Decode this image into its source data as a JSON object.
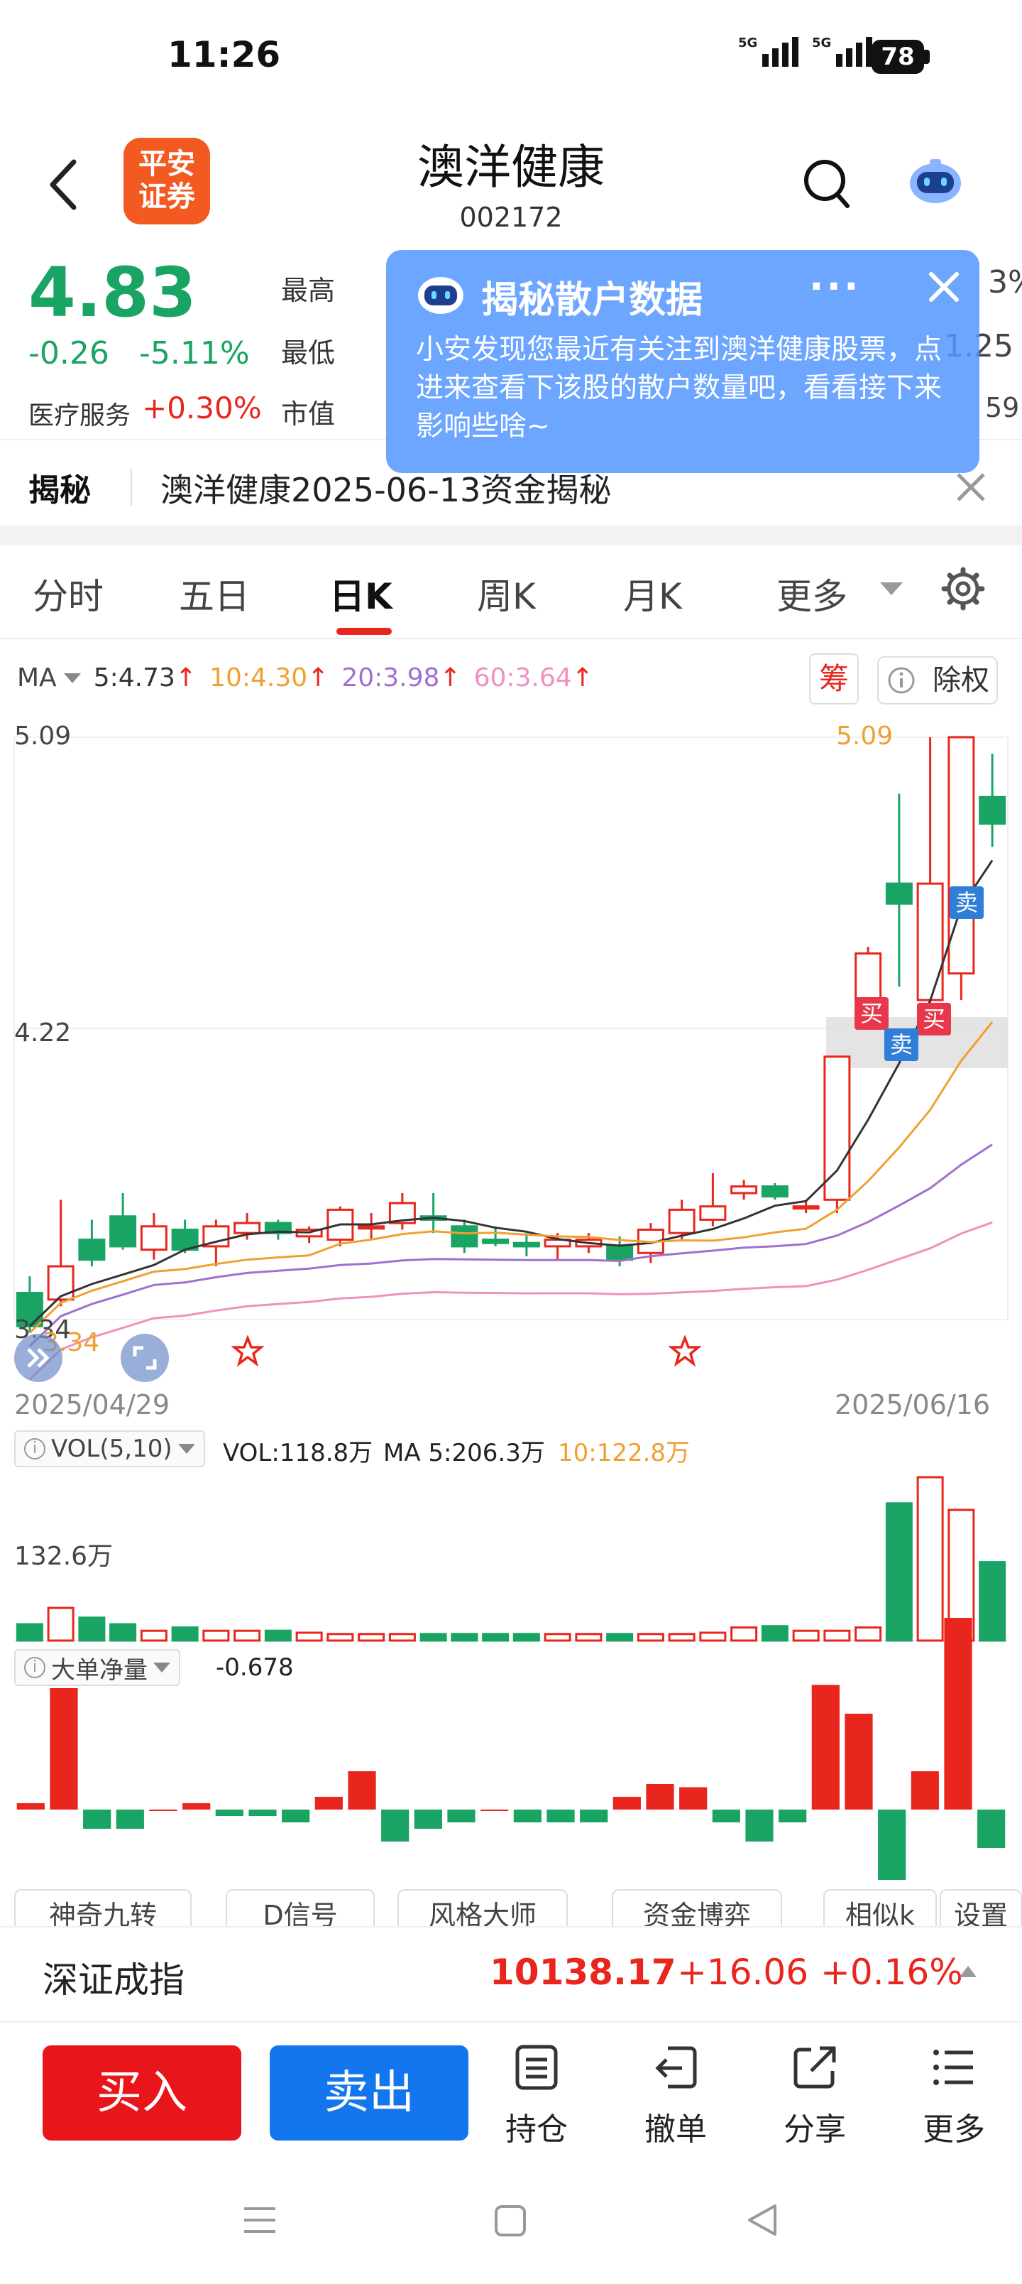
{
  "status_bar": {
    "time": "11:26",
    "signal1": "5G",
    "signal2": "5G",
    "battery": "78"
  },
  "header": {
    "logo_line1": "平安",
    "logo_line2": "证券",
    "title": "澳洋健康",
    "code": "002172"
  },
  "quote": {
    "price": "4.83",
    "change": "-0.26",
    "change_pct": "-5.11%",
    "sector": "医疗服务",
    "sector_change": "+0.30%",
    "label_high": "最高",
    "label_low": "最低",
    "label_mcap": "市值",
    "right_top": "3%",
    "right_mid": "1.25",
    "right_bot": "59"
  },
  "popup": {
    "title": "揭秘散户数据",
    "dots": "···",
    "body": "小安发现您最近有关注到澳洋健康股票，点进来查看下该股的散户数量吧，看看接下来影响些啥~"
  },
  "reveal": {
    "label": "揭秘",
    "text": "澳洋健康2025-06-13资金揭秘"
  },
  "tabs": [
    {
      "label": "分时"
    },
    {
      "label": "五日"
    },
    {
      "label": "日K"
    },
    {
      "label": "周K"
    },
    {
      "label": "月K"
    },
    {
      "label": "更多"
    }
  ],
  "ma_legend": {
    "ma": "MA",
    "ma5": "5:4.73",
    "ma10": "10:4.30",
    "ma20": "20:3.98",
    "ma60": "60:3.64",
    "arrow": "↑",
    "chip_btn": "筹",
    "adj_btn": "除权",
    "colors": {
      "ma5": "#333333",
      "ma10": "#f0a030",
      "ma20": "#a070d0",
      "ma60": "#f090c0"
    }
  },
  "kline_labels": {
    "ytop": "5.09",
    "ymid": "4.22",
    "ylow": "3.34",
    "low_marker": "3.34",
    "high_marker": "5.09",
    "date_start": "2025/04/29",
    "date_end": "2025/06/16",
    "buy": "买",
    "sell": "卖"
  },
  "chart_data": [
    {
      "type": "candlestick",
      "title": "",
      "xlabel": "",
      "ylabel": "",
      "x_range": [
        "2025/04/29",
        "2025/06/16"
      ],
      "ylim": [
        3.34,
        5.09
      ],
      "y_ticks": [
        5.09,
        4.22,
        3.34
      ],
      "candles": [
        {
          "o": 3.42,
          "h": 3.47,
          "l": 3.3,
          "c": 3.32
        },
        {
          "o": 3.4,
          "h": 3.7,
          "l": 3.38,
          "c": 3.5
        },
        {
          "o": 3.58,
          "h": 3.64,
          "l": 3.5,
          "c": 3.52
        },
        {
          "o": 3.65,
          "h": 3.72,
          "l": 3.55,
          "c": 3.56
        },
        {
          "o": 3.55,
          "h": 3.66,
          "l": 3.52,
          "c": 3.62
        },
        {
          "o": 3.61,
          "h": 3.64,
          "l": 3.54,
          "c": 3.55
        },
        {
          "o": 3.56,
          "h": 3.64,
          "l": 3.5,
          "c": 3.62
        },
        {
          "o": 3.6,
          "h": 3.66,
          "l": 3.58,
          "c": 3.63
        },
        {
          "o": 3.63,
          "h": 3.64,
          "l": 3.58,
          "c": 3.6
        },
        {
          "o": 3.59,
          "h": 3.62,
          "l": 3.57,
          "c": 3.61
        },
        {
          "o": 3.58,
          "h": 3.68,
          "l": 3.56,
          "c": 3.67
        },
        {
          "o": 3.62,
          "h": 3.66,
          "l": 3.58,
          "c": 3.62
        },
        {
          "o": 3.63,
          "h": 3.72,
          "l": 3.61,
          "c": 3.69
        },
        {
          "o": 3.65,
          "h": 3.72,
          "l": 3.6,
          "c": 3.64
        },
        {
          "o": 3.62,
          "h": 3.64,
          "l": 3.54,
          "c": 3.56
        },
        {
          "o": 3.58,
          "h": 3.62,
          "l": 3.56,
          "c": 3.57
        },
        {
          "o": 3.57,
          "h": 3.6,
          "l": 3.53,
          "c": 3.56
        },
        {
          "o": 3.56,
          "h": 3.6,
          "l": 3.52,
          "c": 3.58
        },
        {
          "o": 3.56,
          "h": 3.6,
          "l": 3.54,
          "c": 3.58
        },
        {
          "o": 3.56,
          "h": 3.59,
          "l": 3.5,
          "c": 3.52
        },
        {
          "o": 3.54,
          "h": 3.63,
          "l": 3.51,
          "c": 3.61
        },
        {
          "o": 3.6,
          "h": 3.7,
          "l": 3.58,
          "c": 3.67
        },
        {
          "o": 3.64,
          "h": 3.78,
          "l": 3.62,
          "c": 3.68
        },
        {
          "o": 3.72,
          "h": 3.76,
          "l": 3.7,
          "c": 3.74
        },
        {
          "o": 3.74,
          "h": 3.75,
          "l": 3.7,
          "c": 3.71
        },
        {
          "o": 3.68,
          "h": 3.7,
          "l": 3.66,
          "c": 3.68
        },
        {
          "o": 3.7,
          "h": 3.82,
          "l": 3.66,
          "c": 4.13
        },
        {
          "o": 4.3,
          "h": 4.46,
          "l": 4.4,
          "c": 4.44
        },
        {
          "o": 4.65,
          "h": 4.92,
          "l": 4.34,
          "c": 4.59
        },
        {
          "o": 4.3,
          "h": 5.09,
          "l": 4.24,
          "c": 4.65
        },
        {
          "o": 4.38,
          "h": 5.09,
          "l": 4.3,
          "c": 5.09
        },
        {
          "o": 4.91,
          "h": 5.04,
          "l": 4.76,
          "c": 4.83
        }
      ],
      "ma5_last": 4.73,
      "ma10_last": 4.3,
      "ma20_last": 3.98,
      "ma60_last": 3.64
    },
    {
      "type": "bar",
      "title": "VOL(5,10)",
      "series": [
        {
          "name": "VOL",
          "last": "118.8万"
        },
        {
          "name": "MA 5",
          "last": "206.3万"
        },
        {
          "name": "10",
          "last": "122.8万"
        }
      ],
      "y_tick": "132.6万",
      "values": [
        25,
        50,
        35,
        25,
        15,
        20,
        15,
        15,
        15,
        12,
        10,
        10,
        10,
        10,
        10,
        10,
        10,
        10,
        10,
        10,
        10,
        10,
        12,
        20,
        22,
        15,
        15,
        20,
        210,
        250,
        200,
        120
      ]
    },
    {
      "type": "bar",
      "title": "大单净量",
      "last": "-0.678",
      "values": [
        0.1,
        1.9,
        -0.3,
        -0.3,
        0.0,
        0.1,
        -0.1,
        -0.1,
        -0.2,
        0.2,
        0.6,
        -0.5,
        -0.3,
        -0.2,
        0.0,
        -0.2,
        -0.2,
        -0.2,
        0.2,
        0.4,
        0.35,
        -0.2,
        -0.5,
        -0.2,
        1.95,
        1.5,
        -1.1,
        0.6,
        3.0,
        -0.6
      ]
    }
  ],
  "indicator_tabs": [
    "神奇九转",
    "D信号",
    "风格大师",
    "资金博弈",
    "相似k",
    "设置"
  ],
  "volume_legend": {
    "vol_label": "VOL(5,10)",
    "vol_val": "VOL:118.8万",
    "ma5": "MA 5:206.3万",
    "ma10": "10:122.8万",
    "ytick": "132.6万"
  },
  "bigorder_legend": {
    "label": "大单净量",
    "val": "-0.678"
  },
  "index_bar": {
    "name": "深证成指",
    "value": "10138.17",
    "change": "+16.06",
    "pct": "+0.16%"
  },
  "footer": {
    "buy": "买入",
    "sell": "卖出",
    "hold": "持仓",
    "cancel": "撤单",
    "share": "分享",
    "more": "更多"
  }
}
